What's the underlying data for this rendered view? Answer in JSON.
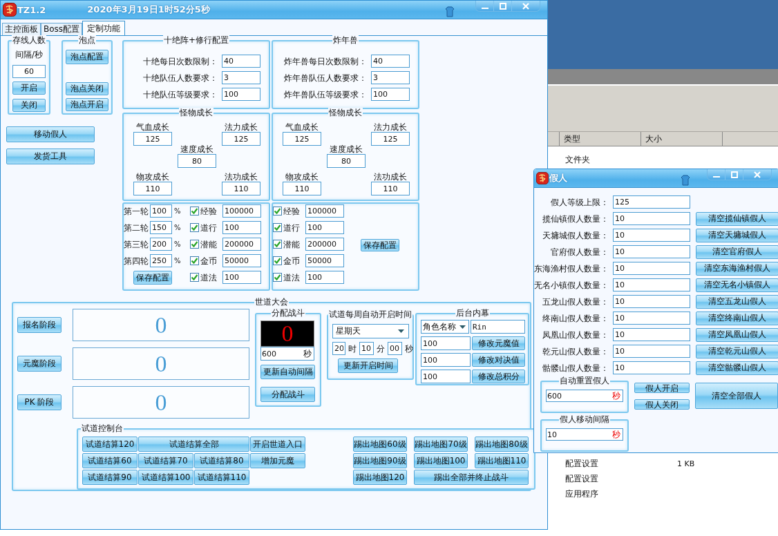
{
  "main_window": {
    "title": "TZ1.2",
    "clock": "2020年3月19日1时52分5秒"
  },
  "tabs": [
    {
      "label": "主控面板",
      "selected": false
    },
    {
      "label": "Boss配置",
      "selected": false
    },
    {
      "label": "定制功能",
      "selected": true
    }
  ],
  "online_count": {
    "title": "存线人数",
    "interval_label": "间隔/秒",
    "interval": "60",
    "buttons": [
      "开启",
      "关闭"
    ]
  },
  "bubble": {
    "title": "泡点",
    "buttons": [
      "泡点配置",
      "泡点关闭",
      "泡点开启"
    ]
  },
  "side_buttons": [
    "移动假人",
    "发货工具"
  ],
  "bosses": [
    {
      "title": "十绝阵+修行配置",
      "fields": [
        {
          "label": "十绝每日次数限制：",
          "value": "40"
        },
        {
          "label": "十绝队伍人数要求：",
          "value": "3"
        },
        {
          "label": "十绝队伍等级要求：",
          "value": "100"
        }
      ],
      "growth": {
        "title": "怪物成长",
        "fields": [
          {
            "label": "气血成长",
            "value": "125"
          },
          {
            "label": "法力成长",
            "value": "125"
          },
          {
            "label": "速度成长",
            "value": "80"
          },
          {
            "label": "物攻成长",
            "value": "110"
          },
          {
            "label": "法功成长",
            "value": "110"
          }
        ]
      },
      "rewards": {
        "rounds": [
          {
            "label": "第一轮",
            "value": "100",
            "unit": "%"
          },
          {
            "label": "第二轮",
            "value": "150",
            "unit": "%"
          },
          {
            "label": "第三轮",
            "value": "200",
            "unit": "%"
          },
          {
            "label": "第四轮",
            "value": "250",
            "unit": "%"
          }
        ],
        "items": [
          {
            "label": "经验",
            "checked": true,
            "value": "100000"
          },
          {
            "label": "道行",
            "checked": true,
            "value": "100"
          },
          {
            "label": "潜能",
            "checked": true,
            "value": "200000"
          },
          {
            "label": "金币",
            "checked": true,
            "value": "50000"
          },
          {
            "label": "道法",
            "checked": true,
            "value": "100"
          }
        ],
        "save": "保存配置"
      }
    },
    {
      "title": "炸年兽",
      "fields": [
        {
          "label": "炸年兽每日次数限制：",
          "value": "40"
        },
        {
          "label": "炸年兽队伍人数要求：",
          "value": "3"
        },
        {
          "label": "炸年兽队伍等级要求：",
          "value": "100"
        }
      ],
      "growth": {
        "title": "怪物成长",
        "fields": [
          {
            "label": "气血成长",
            "value": "125"
          },
          {
            "label": "法力成长",
            "value": "125"
          },
          {
            "label": "速度成长",
            "value": "80"
          },
          {
            "label": "物攻成长",
            "value": "110"
          },
          {
            "label": "法功成长",
            "value": "110"
          }
        ]
      },
      "rewards": {
        "items": [
          {
            "label": "经验",
            "checked": true,
            "value": "100000"
          },
          {
            "label": "道行",
            "checked": true,
            "value": "100"
          },
          {
            "label": "潜能",
            "checked": true,
            "value": "200000"
          },
          {
            "label": "金币",
            "checked": true,
            "value": "50000"
          },
          {
            "label": "道法",
            "checked": true,
            "value": "100"
          }
        ],
        "save": "保存配置"
      }
    }
  ],
  "tournament": {
    "title": "世道大会",
    "stages": [
      {
        "button": "报名阶段",
        "count": "0"
      },
      {
        "button": "元魔阶段",
        "count": "0"
      },
      {
        "button": "PK 阶段",
        "count": "0"
      }
    ],
    "battle": {
      "title": "分配战斗",
      "count": "0",
      "seconds": "600",
      "unit": "秒",
      "buttons": [
        "更新自动间隔",
        "分配战斗"
      ]
    },
    "schedule": {
      "title": "试道每周自动开启时间",
      "day": "星期天",
      "hour": "20",
      "hour_unit": "时",
      "minute": "10",
      "minute_unit": "分",
      "second": "00",
      "second_unit": "秒",
      "button": "更新开启时间"
    },
    "backstage": {
      "title": "后台内幕",
      "selector": "角色名称",
      "name": "Rin",
      "rows": [
        {
          "value": "100",
          "button": "修改元魔值"
        },
        {
          "value": "100",
          "button": "修改对决值"
        },
        {
          "value": "100",
          "button": "修改总积分"
        }
      ]
    },
    "console": {
      "title": "试道控制台",
      "settle_buttons": [
        {
          "label": "试道结算120",
          "wide": false
        },
        {
          "label": "试道结算全部",
          "wide": true
        },
        {
          "label": "开启世道入口",
          "wide": false
        },
        {
          "label": "试道结算60",
          "wide": false
        },
        {
          "label": "试道结算70",
          "wide": false
        },
        {
          "label": "试道结算80",
          "wide": false
        },
        {
          "label": "增加元魔",
          "wide": false
        },
        {
          "label": "试道结算90",
          "wide": false
        },
        {
          "label": "试道结算100",
          "wide": false
        },
        {
          "label": "试道结算110",
          "wide": false
        }
      ],
      "kick_buttons": [
        {
          "label": "踢出地图60级",
          "wide": false
        },
        {
          "label": "踢出地图70级",
          "wide": false
        },
        {
          "label": "踢出地图80级",
          "wide": false
        },
        {
          "label": "踢出地图90级",
          "wide": false
        },
        {
          "label": "踢出地图100",
          "wide": false
        },
        {
          "label": "踢出地图110",
          "wide": false
        },
        {
          "label": "踢出地图120",
          "wide": false
        },
        {
          "label": "踢出全部并终止战斗",
          "wide": true
        }
      ]
    }
  },
  "npc_window": {
    "title": "假人",
    "level_label": "假人等级上限：",
    "level": "125",
    "towns": [
      {
        "label": "揽仙镇假人数量：",
        "value": "10",
        "clear": "清空揽仙镇假人"
      },
      {
        "label": "天墉城假人数量：",
        "value": "10",
        "clear": "清空天墉城假人"
      },
      {
        "label": "官府假人数量：",
        "value": "10",
        "clear": "清空官府假人"
      },
      {
        "label": "东海渔村假人数量：",
        "value": "10",
        "clear": "清空东海渔村假人"
      },
      {
        "label": "无名小镇假人数量：",
        "value": "10",
        "clear": "清空无名小镇假人"
      },
      {
        "label": "五龙山假人数量：",
        "value": "10",
        "clear": "清空五龙山假人"
      },
      {
        "label": "终南山假人数量：",
        "value": "10",
        "clear": "清空终南山假人"
      },
      {
        "label": "凤凰山假人数量：",
        "value": "10",
        "clear": "清空凤凰山假人"
      },
      {
        "label": "乾元山假人数量：",
        "value": "10",
        "clear": "清空乾元山假人"
      },
      {
        "label": "骷髅山假人数量：",
        "value": "10",
        "clear": "清空骷髅山假人"
      }
    ],
    "reset": {
      "title": "自动重置假人",
      "value": "600",
      "unit": "秒"
    },
    "on": "假人开启",
    "off": "假人关闭",
    "clear_all": "清空全部假人",
    "move": {
      "title": "假人移动间隔",
      "value": "10",
      "unit": "秒"
    }
  },
  "explorer": {
    "columns": [
      "类型",
      "大小"
    ],
    "top_rows": [
      {
        "type": "文件夹"
      }
    ],
    "bottom_rows": [
      {
        "type": "配置设置",
        "size": "1 KB"
      },
      {
        "type": "配置设置"
      },
      {
        "type": "应用程序"
      }
    ]
  }
}
